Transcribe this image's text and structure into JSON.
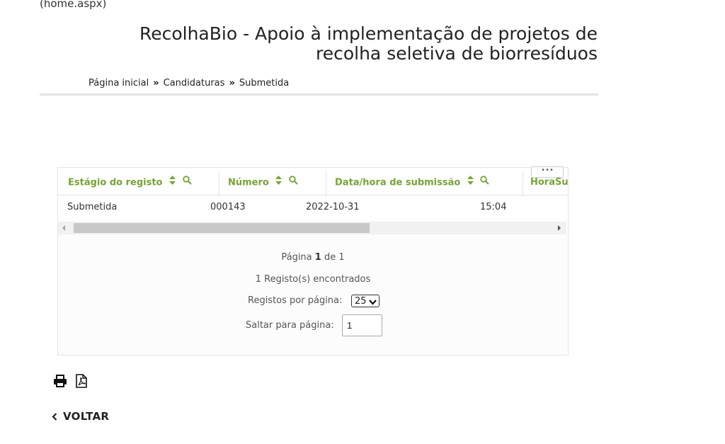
{
  "url_note": "(home.aspx)",
  "title": {
    "line1": "RecolhaBio - Apoio à implementação de projetos de",
    "line2": "recolha seletiva de biorresíduos"
  },
  "breadcrumb": {
    "items": [
      "Página inicial",
      "Candidaturas",
      "Submetida"
    ],
    "separator": "»"
  },
  "grid": {
    "more_button": "•••",
    "columns": [
      {
        "label": "Estágio do registo"
      },
      {
        "label": "Número"
      },
      {
        "label": "Data/hora de submissão"
      },
      {
        "label": "HoraSul"
      }
    ],
    "rows": [
      {
        "estagio": "Submetida",
        "numero": "000143",
        "data": "2022-10-31",
        "hora": "15:04"
      }
    ],
    "pager": {
      "prefix": "Página",
      "current": "1",
      "middle": "de",
      "total": "1",
      "found": "1 Registo(s) encontrados",
      "per_page_label": "Registos por página:",
      "per_page_value": "25",
      "jump_label": "Saltar para página:",
      "jump_value": "1"
    }
  },
  "tools": {
    "print_icon": "print-icon",
    "pdf_icon": "pdf-icon"
  },
  "back": {
    "label": "VOLTAR"
  },
  "colors": {
    "accent": "#77a337",
    "text": "#333333",
    "border": "#e5e5e5"
  }
}
